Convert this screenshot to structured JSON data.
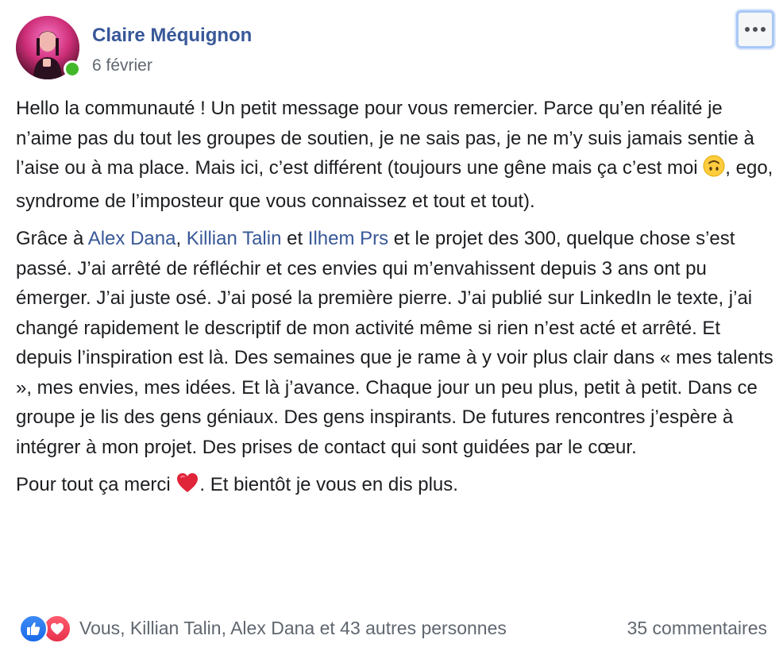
{
  "post": {
    "author": {
      "name": "Claire Méquignon",
      "online": true
    },
    "date": "6 février",
    "paragraphs": {
      "p1": {
        "text": "Hello la communauté ! Un petit message pour vous remercier. Parce qu’en réalité je n’aime pas du tout les groupes de soutien, je ne sais pas, je ne m’y suis jamais sentie à l’aise ou à ma place. Mais ici, c’est différent (toujours une gêne mais ça c’est moi ",
        "emoji": "upside-down-face",
        "after": ", ego, syndrome de l’imposteur que vous connaissez et tout et tout)."
      },
      "p2": {
        "intro": "Grâce à ",
        "mention1": "Alex Dana",
        "sep1": ", ",
        "mention2": "Killian Talin",
        "sep2": " et ",
        "mention3": "Ilhem Prs",
        "rest": " et le projet des 300, quelque chose s’est passé. J’ai arrêté de réfléchir et ces envies qui m’envahissent depuis 3 ans ont pu émerger. J’ai juste osé. J’ai posé la première pierre. J’ai publié sur LinkedIn le texte, j’ai changé rapidement le descriptif de mon activité même si rien n’est acté et arrêté. Et depuis l’inspiration est là. Des semaines que je rame à y voir plus clair dans « mes talents », mes envies, mes idées. Et là j’avance. Chaque jour un peu plus, petit à petit. Dans ce groupe je lis des gens géniaux. Des gens inspirants. De futures rencontres j’espère à intégrer à mon projet. Des prises de contact qui sont guidées par le cœur."
      },
      "p3": {
        "text": "Pour tout ça merci ",
        "emoji": "red-heart",
        "after": ". Et bientôt je vous en dis plus."
      }
    },
    "reactions": {
      "icons": [
        "like-icon",
        "love-icon"
      ],
      "summary": "Vous, Killian Talin, Alex Dana et 43 autres personnes"
    },
    "comments_count": "35 commentaires"
  },
  "colors": {
    "link": "#385898",
    "secondary_text": "#606770",
    "online": "#42b72a",
    "like": "#1a6ae8",
    "love": "#e7314b"
  }
}
